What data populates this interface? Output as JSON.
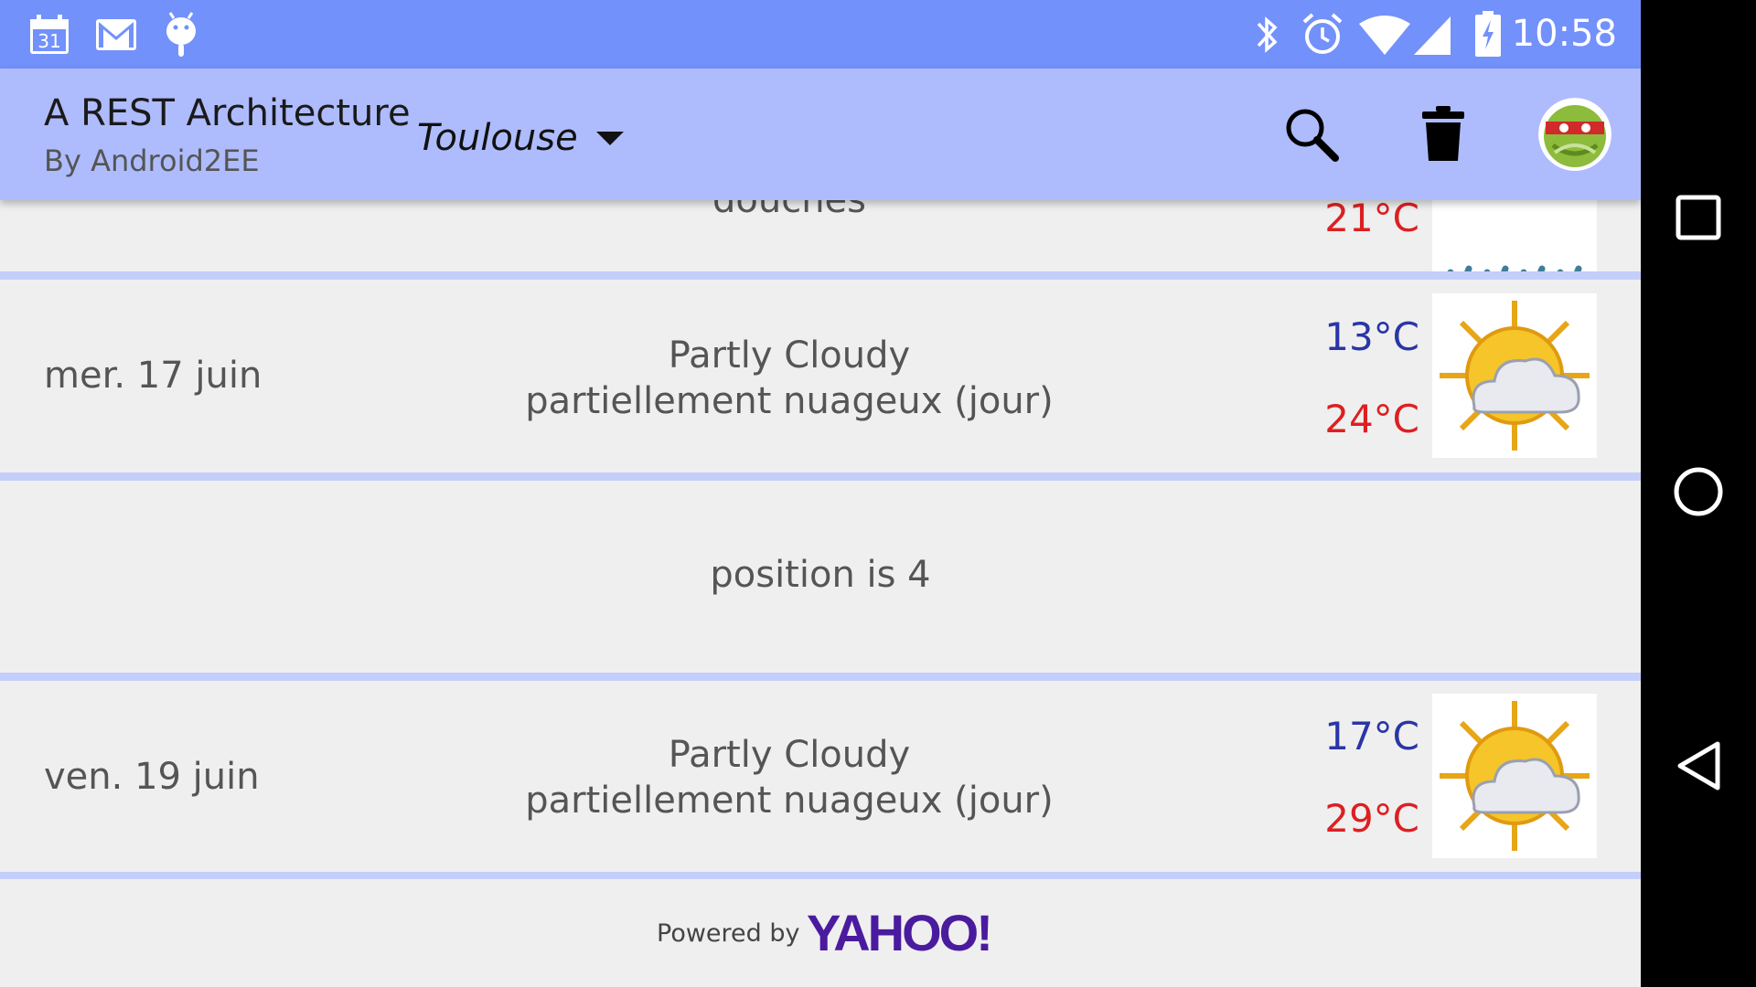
{
  "status_bar": {
    "time": "10:58",
    "calendar_day": "31",
    "icons": [
      "calendar-icon",
      "gmail-icon",
      "android-debug-icon",
      "bluetooth-icon",
      "alarm-icon",
      "wifi-icon",
      "signal-icon",
      "battery-charging-icon"
    ]
  },
  "action_bar": {
    "title": "A REST Architecture",
    "subtitle": "By Android2EE",
    "city": "Toulouse",
    "actions": [
      "search-icon",
      "trash-icon",
      "avatar"
    ]
  },
  "forecast_partial": {
    "description": "douches",
    "high": "21°C",
    "icon": "showers-icon"
  },
  "forecast_rows": [
    {
      "date": "mer. 17 juin",
      "description_en": "Partly Cloudy",
      "description_fr": "partiellement nuageux (jour)",
      "low": "13°C",
      "high": "24°C",
      "icon": "partly-cloudy-icon"
    },
    {
      "date": "ven. 19 juin",
      "description_en": "Partly Cloudy",
      "description_fr": "partiellement nuageux (jour)",
      "low": "17°C",
      "high": "29°C",
      "icon": "partly-cloudy-icon"
    }
  ],
  "position_row": {
    "text": "position is 4"
  },
  "footer": {
    "powered": "Powered by",
    "brand": "YAHOO!"
  },
  "colors": {
    "status_bar": "#7391fb",
    "action_bar": "#aebcfd",
    "separator": "#c4cefa",
    "temp_low": "#2a35a6",
    "temp_high": "#dd1f22",
    "yahoo": "#4a1b9e"
  },
  "nav_bar": [
    "recents-icon",
    "home-icon",
    "back-icon"
  ]
}
